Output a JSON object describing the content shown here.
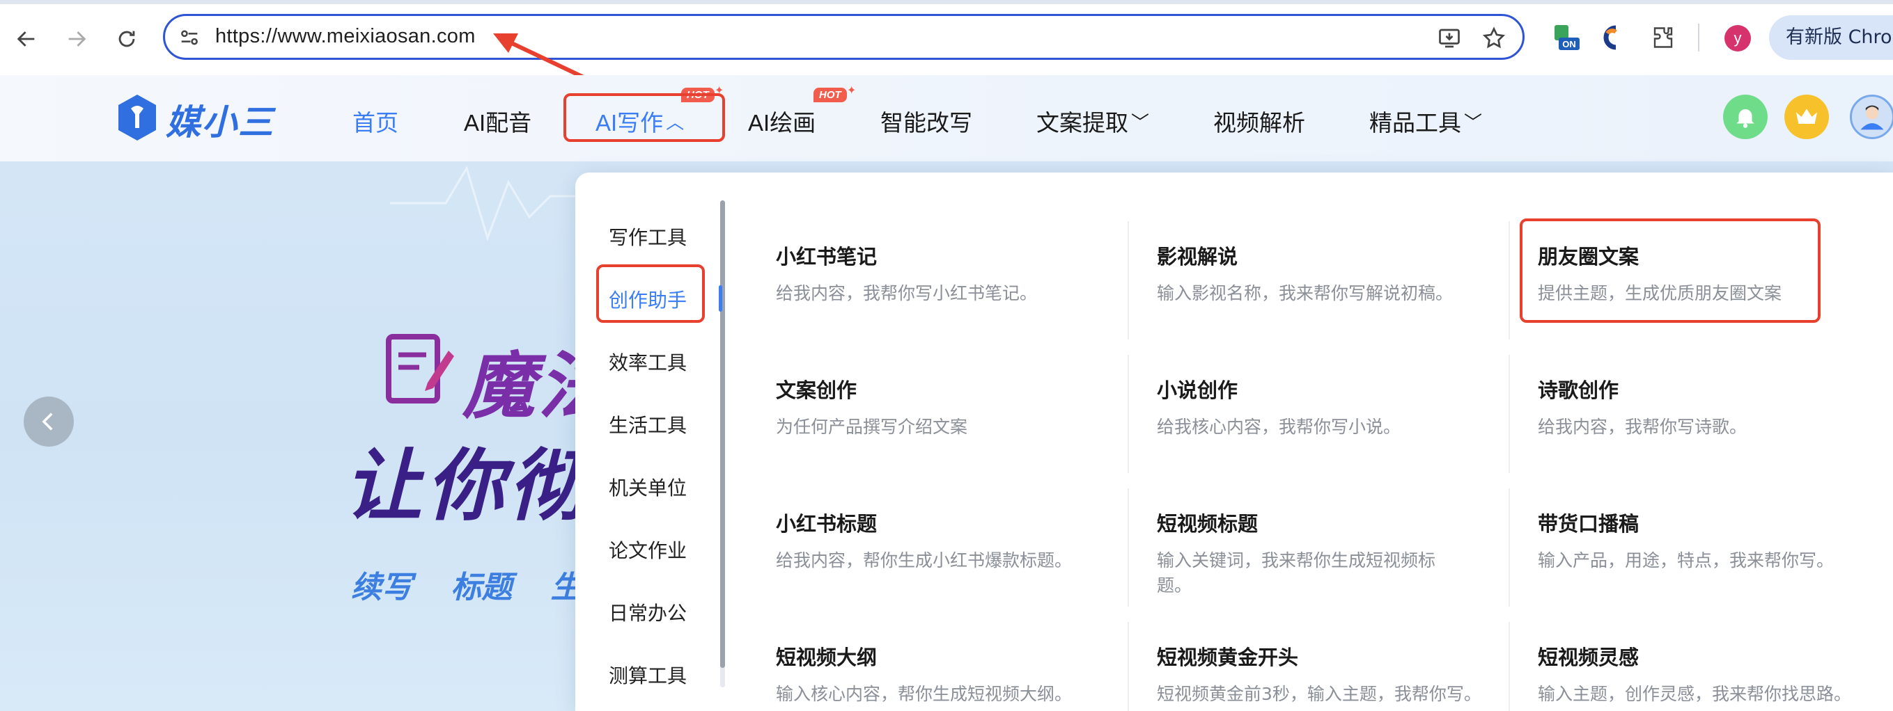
{
  "browser": {
    "url": "https://www.meixiaosan.com",
    "profile_initial": "y",
    "update_label": "有新版 Chrome",
    "ext_badge": "ON"
  },
  "site": {
    "logo_text": "媒小三",
    "nav": [
      {
        "label": "首页",
        "active": true
      },
      {
        "label": "AI配音"
      },
      {
        "label": "AI写作",
        "chevron": "⌃"
      },
      {
        "label": "AI绘画"
      },
      {
        "label": "智能改写"
      },
      {
        "label": "文案提取",
        "chevron": "⌄"
      },
      {
        "label": "视频解析"
      },
      {
        "label": "精品工具",
        "chevron": "⌄"
      }
    ],
    "hot_label": "HOT"
  },
  "hero": {
    "line1": "魔法",
    "line2": "让你彻底",
    "tags": "续写 标题 生成"
  },
  "dropdown": {
    "categories": [
      "写作工具",
      "创作助手",
      "效率工具",
      "生活工具",
      "机关单位",
      "论文作业",
      "日常办公",
      "测算工具"
    ],
    "tools": [
      {
        "title": "小红书笔记",
        "desc": "给我内容，我帮你写小红书笔记。"
      },
      {
        "title": "影视解说",
        "desc": "输入影视名称，我来帮你写解说初稿。"
      },
      {
        "title": "朋友圈文案",
        "desc": "提供主题，生成优质朋友圈文案"
      },
      {
        "title": "文案创作",
        "desc": "为任何产品撰写介绍文案"
      },
      {
        "title": "小说创作",
        "desc": "给我核心内容，我帮你写小说。"
      },
      {
        "title": "诗歌创作",
        "desc": "给我内容，我帮你写诗歌。"
      },
      {
        "title": "小红书标题",
        "desc": "给我内容，帮你生成小红书爆款标题。"
      },
      {
        "title": "短视频标题",
        "desc": "输入关键词，我来帮你生成短视频标题。"
      },
      {
        "title": "带货口播稿",
        "desc": "输入产品，用途，特点，我来帮你写。"
      },
      {
        "title": "短视频大纲",
        "desc": "输入核心内容，帮你生成短视频大纲。"
      },
      {
        "title": "短视频黄金开头",
        "desc": "短视频黄金前3秒，输入主题，我帮你写。"
      },
      {
        "title": "短视频灵感",
        "desc": "输入主题，创作灵感，我来帮你找思路。"
      }
    ]
  },
  "colors": {
    "accent": "#3b7df5",
    "highlight": "#e8402e",
    "omnibox_border": "#2f54d6"
  }
}
